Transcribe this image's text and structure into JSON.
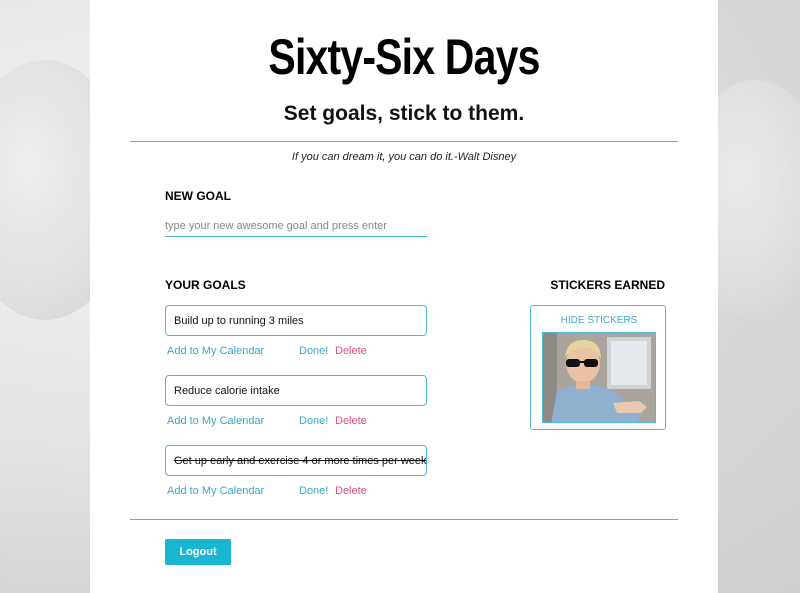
{
  "app": {
    "title": "Sixty-Six Days",
    "tagline": "Set goals, stick to them.",
    "quote": "If you can dream it, you can do it.-Walt Disney"
  },
  "new_goal": {
    "label": "NEW GOAL",
    "placeholder": "type your new awesome goal and press enter"
  },
  "goals": {
    "label": "YOUR GOALS",
    "items": [
      {
        "text": "Build up to running 3 miles",
        "completed": false
      },
      {
        "text": "Reduce calorie intake",
        "completed": false
      },
      {
        "text": "Get up early and exercise 4 or more times per week",
        "completed": true
      }
    ],
    "actions": {
      "calendar": "Add to My Calendar",
      "done": "Done!",
      "delete": "Delete"
    }
  },
  "stickers": {
    "label": "STICKERS EARNED",
    "toggle": "HIDE STICKERS"
  },
  "logout": "Logout",
  "colors": {
    "accent": "#4fb9d3",
    "link": "#3aa9c6",
    "delete": "#e0507a",
    "button": "#19b6d2"
  }
}
